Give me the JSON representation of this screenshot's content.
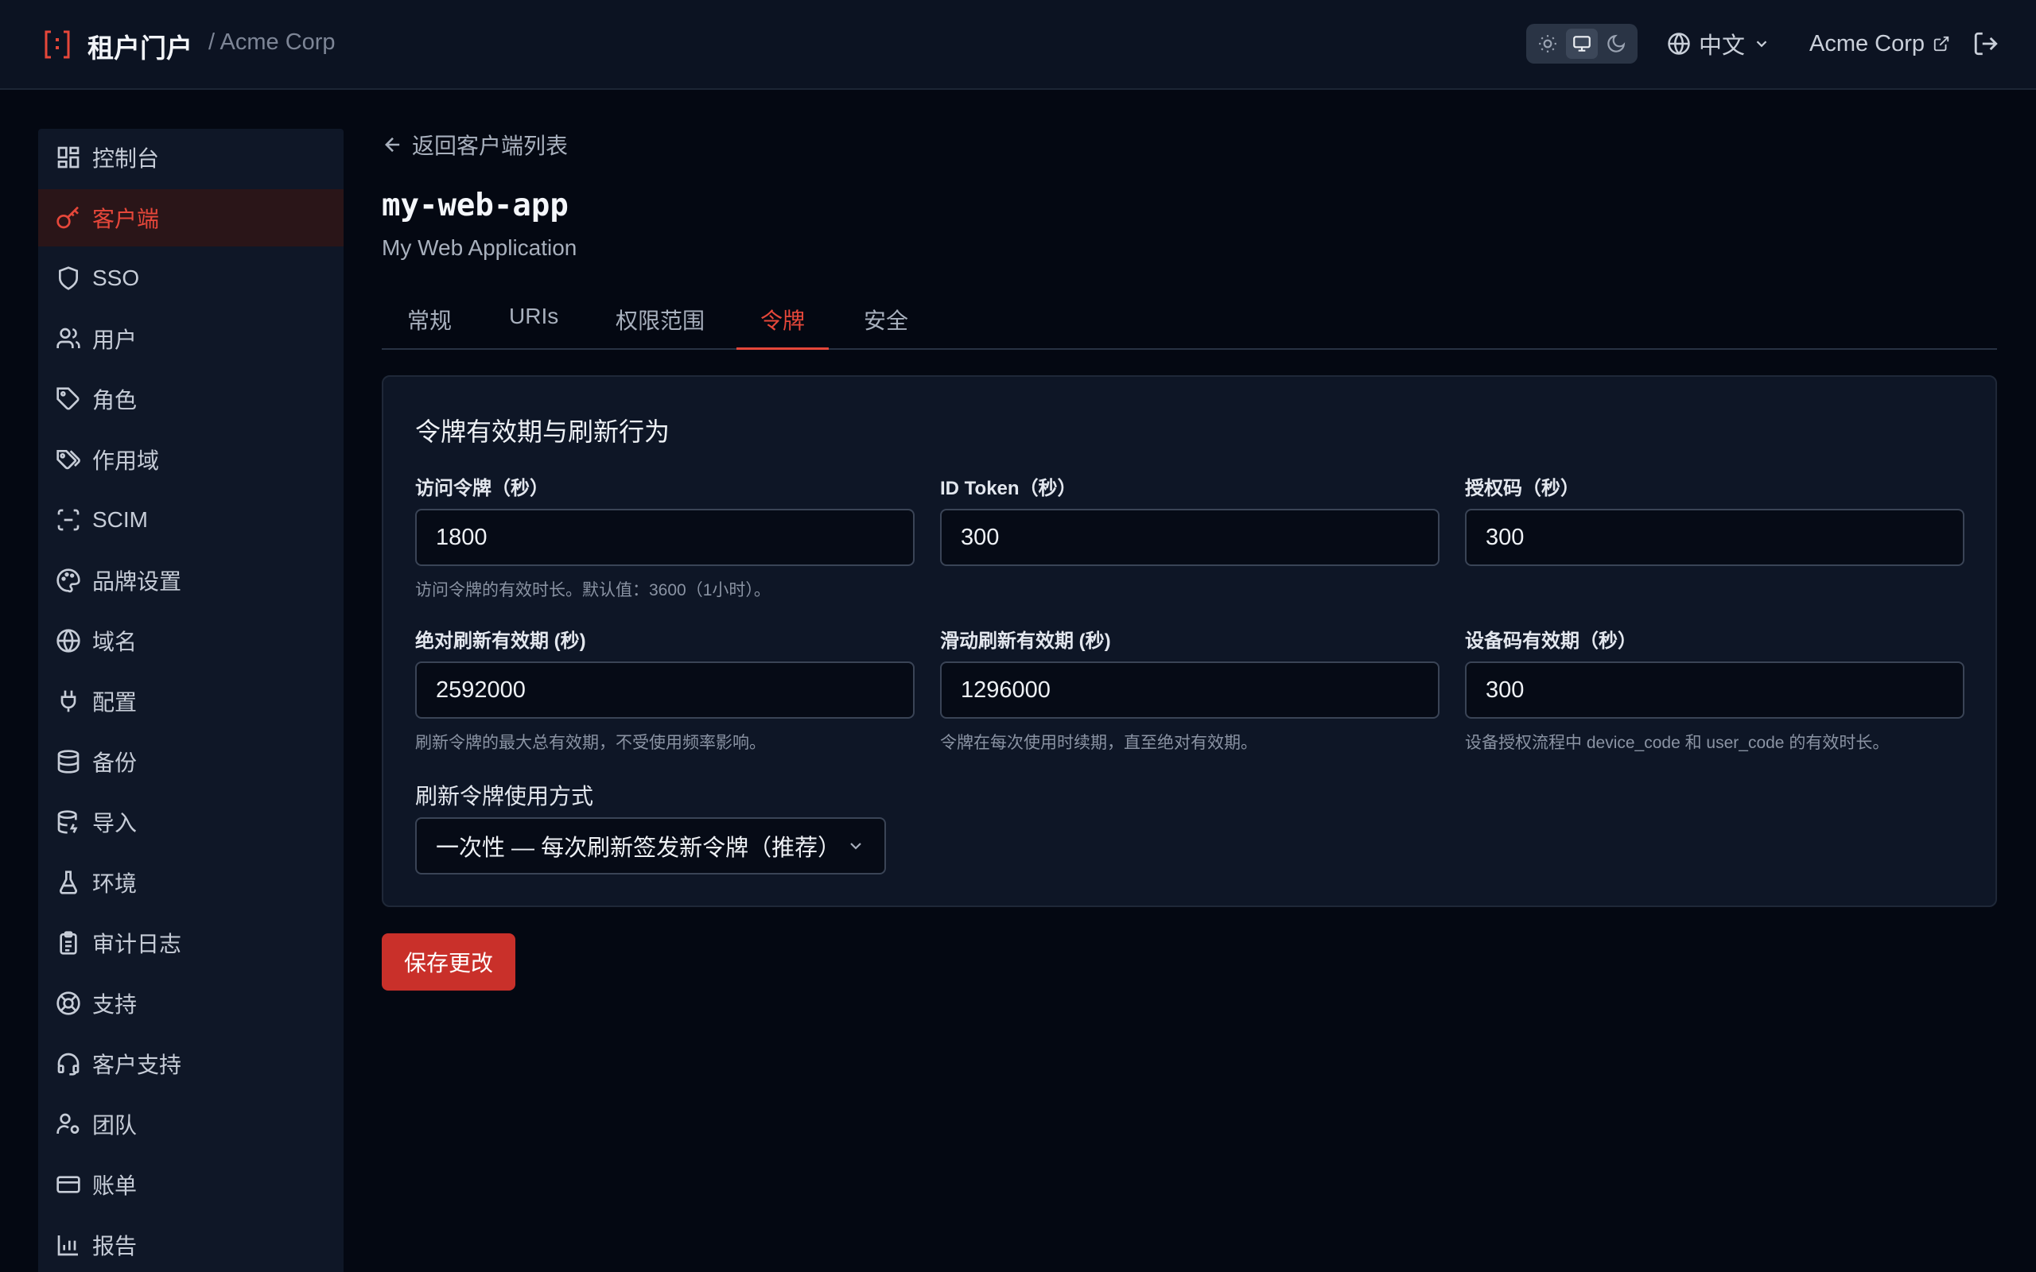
{
  "header": {
    "brand": "租户门户",
    "tenant_crumb": "/ Acme Corp",
    "language": "中文",
    "tenant_link": "Acme Corp",
    "theme_icons": [
      "sun-icon",
      "monitor-icon",
      "moon-icon"
    ]
  },
  "sidebar": {
    "items": [
      {
        "label": "控制台",
        "icon": "dashboard-icon"
      },
      {
        "label": "客户端",
        "icon": "key-icon",
        "active": true
      },
      {
        "label": "SSO",
        "icon": "shield-icon"
      },
      {
        "label": "用户",
        "icon": "users-icon"
      },
      {
        "label": "角色",
        "icon": "tag-icon"
      },
      {
        "label": "作用域",
        "icon": "tags-icon"
      },
      {
        "label": "SCIM",
        "icon": "scan-icon"
      },
      {
        "label": "品牌设置",
        "icon": "palette-icon"
      },
      {
        "label": "域名",
        "icon": "globe-icon"
      },
      {
        "label": "配置",
        "icon": "plug-icon"
      },
      {
        "label": "备份",
        "icon": "database-icon"
      },
      {
        "label": "导入",
        "icon": "database-import-icon"
      },
      {
        "label": "环境",
        "icon": "flask-icon"
      },
      {
        "label": "审计日志",
        "icon": "clipboard-icon"
      },
      {
        "label": "支持",
        "icon": "lifebuoy-icon"
      },
      {
        "label": "客户支持",
        "icon": "headset-icon"
      },
      {
        "label": "团队",
        "icon": "user-gear-icon"
      },
      {
        "label": "账单",
        "icon": "credit-card-icon"
      },
      {
        "label": "报告",
        "icon": "bar-chart-icon"
      }
    ]
  },
  "page": {
    "back_label": "返回客户端列表",
    "client_id": "my-web-app",
    "client_name": "My Web Application",
    "tabs": [
      "常规",
      "URIs",
      "权限范围",
      "令牌",
      "安全"
    ],
    "active_tab": "令牌"
  },
  "card": {
    "title": "令牌有效期与刷新行为",
    "fields": [
      {
        "label": "访问令牌（秒）",
        "value": "1800",
        "hint": "访问令牌的有效时长。默认值：3600（1小时）。"
      },
      {
        "label": "ID Token（秒）",
        "value": "300",
        "hint": ""
      },
      {
        "label": "授权码（秒）",
        "value": "300",
        "hint": ""
      },
      {
        "label": "绝对刷新有效期 (秒)",
        "value": "2592000",
        "hint": "刷新令牌的最大总有效期，不受使用频率影响。"
      },
      {
        "label": "滑动刷新有效期 (秒)",
        "value": "1296000",
        "hint": "令牌在每次使用时续期，直至绝对有效期。"
      },
      {
        "label": "设备码有效期（秒）",
        "value": "300",
        "hint": "设备授权流程中 device_code 和 user_code 的有效时长。"
      }
    ],
    "refresh_label": "刷新令牌使用方式",
    "refresh_value": "一次性 — 每次刷新签发新令牌（推荐）"
  },
  "save_label": "保存更改",
  "colors": {
    "accent": "#e6473a",
    "primary_button": "#c9302a",
    "background": "#040812"
  }
}
